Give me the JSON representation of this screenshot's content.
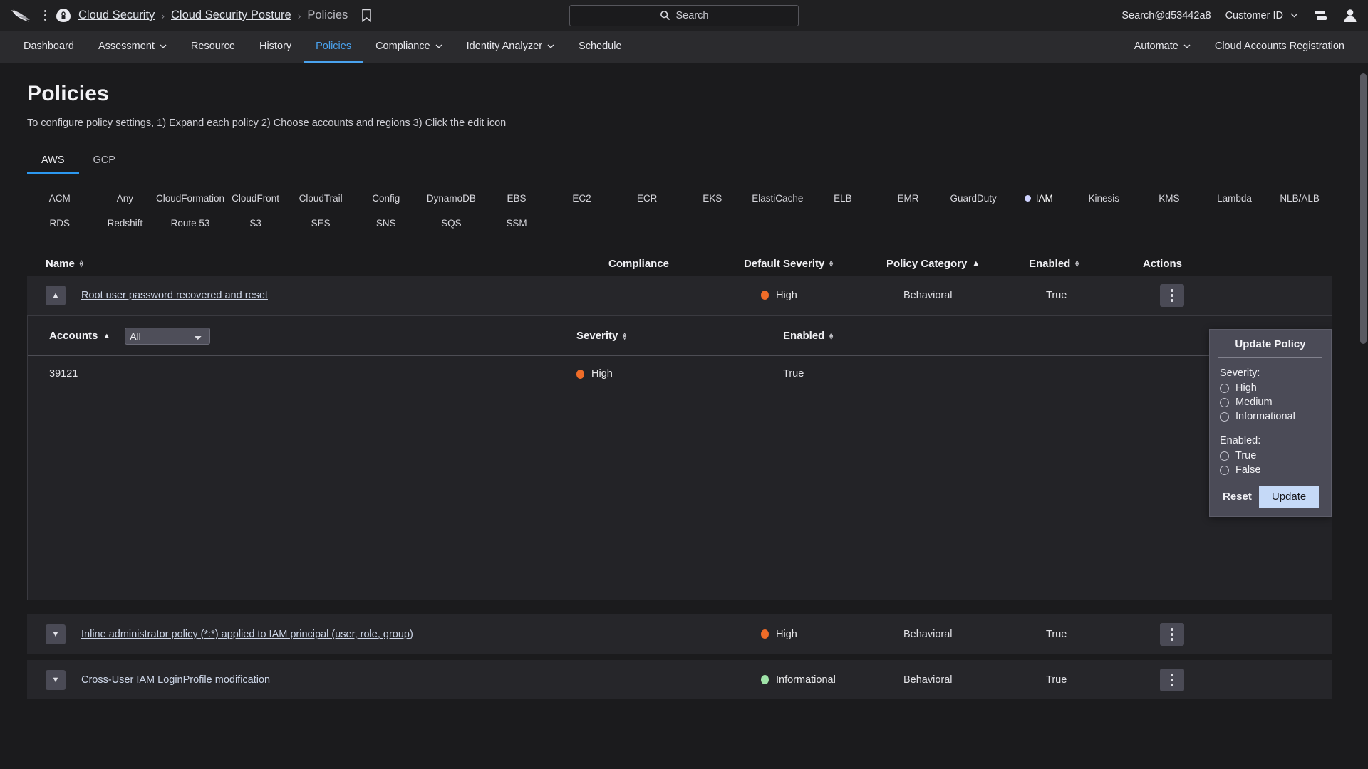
{
  "topbar": {
    "logo_name": "falcon-logo",
    "breadcrumbs": [
      {
        "label": "Cloud Security",
        "link": true
      },
      {
        "label": "Cloud Security Posture",
        "link": true
      },
      {
        "label": "Policies",
        "link": false
      }
    ],
    "separator": "›",
    "search": {
      "placeholder": "Search",
      "icon": "search-icon"
    },
    "account": "Search@d53442a8",
    "customer_id": "Customer ID",
    "chevron": "⌄",
    "icons": [
      "menu-icon",
      "user-avatar-icon",
      "bookmark-icon",
      "cloud-icon",
      "kebab-menu-icon"
    ]
  },
  "nav": {
    "items": [
      {
        "label": "Dashboard",
        "caret": false,
        "active": false
      },
      {
        "label": "Assessment",
        "caret": true,
        "active": false
      },
      {
        "label": "Resource",
        "caret": false,
        "active": false
      },
      {
        "label": "History",
        "caret": false,
        "active": false
      },
      {
        "label": "Policies",
        "caret": false,
        "active": true
      },
      {
        "label": "Compliance",
        "caret": true,
        "active": false
      },
      {
        "label": "Identity Analyzer",
        "caret": true,
        "active": false
      },
      {
        "label": "Schedule",
        "caret": false,
        "active": false
      }
    ],
    "right_items": [
      {
        "label": "Automate",
        "caret": true
      },
      {
        "label": "Cloud Accounts Registration",
        "caret": false
      }
    ]
  },
  "page": {
    "title": "Policies",
    "subtitle": "To configure policy settings, 1) Expand each policy 2) Choose accounts and regions 3) Click the edit icon"
  },
  "tabs": [
    {
      "label": "AWS",
      "active": true
    },
    {
      "label": "GCP",
      "active": false
    }
  ],
  "service_chips": [
    {
      "label": "ACM",
      "selected": false
    },
    {
      "label": "Any",
      "selected": false
    },
    {
      "label": "CloudFormation",
      "selected": false
    },
    {
      "label": "CloudFront",
      "selected": false
    },
    {
      "label": "CloudTrail",
      "selected": false
    },
    {
      "label": "Config",
      "selected": false
    },
    {
      "label": "DynamoDB",
      "selected": false
    },
    {
      "label": "EBS",
      "selected": false
    },
    {
      "label": "EC2",
      "selected": false
    },
    {
      "label": "ECR",
      "selected": false
    },
    {
      "label": "EKS",
      "selected": false
    },
    {
      "label": "ElastiCache",
      "selected": false
    },
    {
      "label": "ELB",
      "selected": false
    },
    {
      "label": "EMR",
      "selected": false
    },
    {
      "label": "GuardDuty",
      "selected": false
    },
    {
      "label": "IAM",
      "selected": true
    },
    {
      "label": "Kinesis",
      "selected": false
    },
    {
      "label": "KMS",
      "selected": false
    },
    {
      "label": "Lambda",
      "selected": false
    },
    {
      "label": "NLB/ALB",
      "selected": false
    },
    {
      "label": "RDS",
      "selected": false
    },
    {
      "label": "Redshift",
      "selected": false
    },
    {
      "label": "Route 53",
      "selected": false
    },
    {
      "label": "S3",
      "selected": false
    },
    {
      "label": "SES",
      "selected": false
    },
    {
      "label": "SNS",
      "selected": false
    },
    {
      "label": "SQS",
      "selected": false
    },
    {
      "label": "SSM",
      "selected": false
    }
  ],
  "table": {
    "headers": {
      "name": "Name",
      "compliance": "Compliance",
      "default_severity": "Default Severity",
      "policy_category": "Policy Category",
      "enabled": "Enabled",
      "actions": "Actions"
    },
    "sort": {
      "policy_category": "asc"
    },
    "rows": [
      {
        "name": "Root user password recovered and reset",
        "compliance": "",
        "severity": "High",
        "severity_color": "#ef6c28",
        "category": "Behavioral",
        "enabled": "True",
        "expanded": true
      },
      {
        "name": "Inline administrator policy (*:*) applied to IAM principal (user, role, group)",
        "compliance": "",
        "severity": "High",
        "severity_color": "#ef6c28",
        "category": "Behavioral",
        "enabled": "True",
        "expanded": false
      },
      {
        "name": "Cross-User IAM LoginProfile modification",
        "compliance": "",
        "severity": "Informational",
        "severity_color": "#9fe3a8",
        "category": "Behavioral",
        "enabled": "True",
        "expanded": false
      }
    ]
  },
  "expanded_panel": {
    "headers": {
      "accounts": "Accounts",
      "severity": "Severity",
      "enabled": "Enabled"
    },
    "account_filter": {
      "value": "All",
      "options": [
        "All"
      ]
    },
    "rows": [
      {
        "account": "39121",
        "severity": "High",
        "severity_color": "#ef6c28",
        "enabled": "True"
      }
    ]
  },
  "update_policy": {
    "title": "Update Policy",
    "severity_label": "Severity:",
    "severity_options": [
      {
        "label": "High",
        "selected": false
      },
      {
        "label": "Medium",
        "selected": false
      },
      {
        "label": "Informational",
        "selected": false
      }
    ],
    "enabled_label": "Enabled:",
    "enabled_options": [
      {
        "label": "True",
        "selected": false
      },
      {
        "label": "False",
        "selected": false
      }
    ],
    "reset_label": "Reset",
    "update_label": "Update",
    "update_button_color": "#c5d9f7"
  }
}
